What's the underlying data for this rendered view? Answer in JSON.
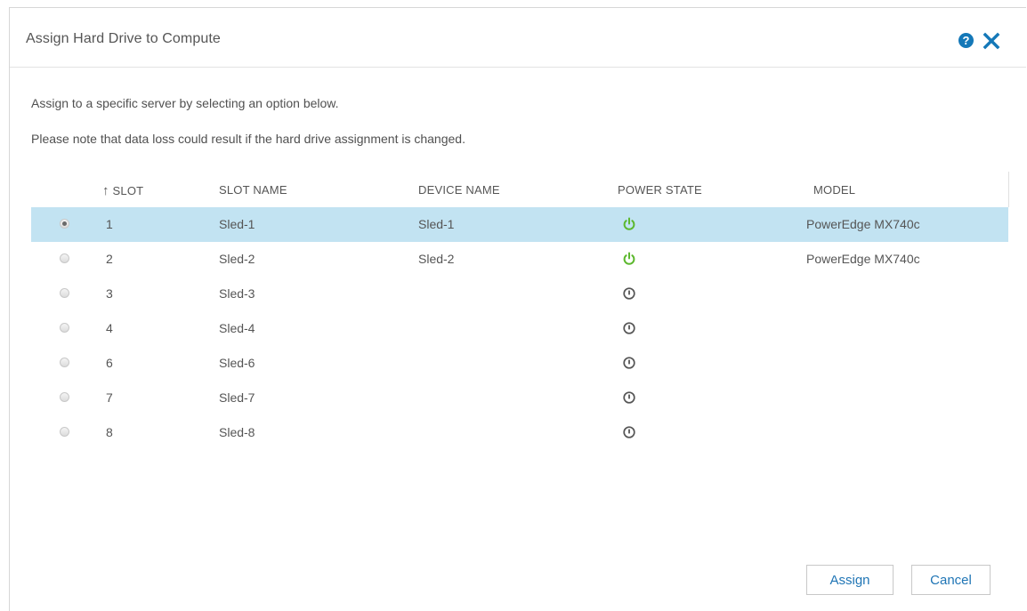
{
  "dialog": {
    "title": "Assign Hard Drive to Compute",
    "help_icon": "question-circle-icon",
    "help_glyph": "?",
    "close_icon": "close-x-icon"
  },
  "instructions": {
    "line1": "Assign to a specific server by selecting an option below.",
    "line2": "Please note that data loss could result if the hard drive assignment is changed."
  },
  "table": {
    "columns": {
      "slot": "SLOT",
      "slot_sort_arrow": "↑",
      "slot_name": "SLOT NAME",
      "device_name": "DEVICE NAME",
      "power_state": "POWER STATE",
      "model": "MODEL"
    },
    "rows": [
      {
        "slot": "1",
        "slot_name": "Sled-1",
        "device_name": "Sled-1",
        "power": "on",
        "model": "PowerEdge MX740c",
        "selected": true
      },
      {
        "slot": "2",
        "slot_name": "Sled-2",
        "device_name": "Sled-2",
        "power": "on",
        "model": "PowerEdge MX740c",
        "selected": false
      },
      {
        "slot": "3",
        "slot_name": "Sled-3",
        "device_name": "",
        "power": "off",
        "model": "",
        "selected": false
      },
      {
        "slot": "4",
        "slot_name": "Sled-4",
        "device_name": "",
        "power": "off",
        "model": "",
        "selected": false
      },
      {
        "slot": "6",
        "slot_name": "Sled-6",
        "device_name": "",
        "power": "off",
        "model": "",
        "selected": false
      },
      {
        "slot": "7",
        "slot_name": "Sled-7",
        "device_name": "",
        "power": "off",
        "model": "",
        "selected": false
      },
      {
        "slot": "8",
        "slot_name": "Sled-8",
        "device_name": "",
        "power": "off",
        "model": "",
        "selected": false
      }
    ]
  },
  "buttons": {
    "assign": "Assign",
    "cancel": "Cancel"
  },
  "colors": {
    "accent": "#1f75b5",
    "selected_row": "#c2e3f2",
    "power_on": "#5cb82e",
    "power_off": "#555555"
  }
}
